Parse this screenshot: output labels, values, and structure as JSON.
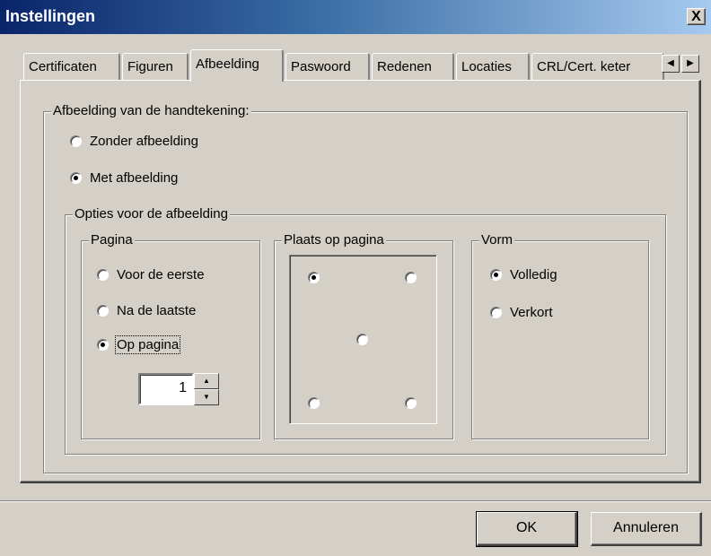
{
  "window": {
    "title": "Instellingen",
    "close_label": "X"
  },
  "tabs": [
    {
      "label": "Certificaten"
    },
    {
      "label": "Figuren"
    },
    {
      "label": "Afbeelding",
      "active": true
    },
    {
      "label": "Paswoord"
    },
    {
      "label": "Redenen"
    },
    {
      "label": "Locaties"
    },
    {
      "label": "CRL/Cert. keter"
    }
  ],
  "tab_scroll": {
    "left": "◀",
    "right": "▶"
  },
  "signature_image": {
    "legend": "Afbeelding van de handtekening:",
    "options": [
      {
        "label": "Zonder afbeelding",
        "selected": false
      },
      {
        "label": "Met afbeelding",
        "selected": true
      }
    ]
  },
  "image_options": {
    "legend": "Opties voor de afbeelding",
    "page": {
      "legend": "Pagina",
      "options": [
        {
          "label": "Voor de eerste",
          "selected": false
        },
        {
          "label": "Na de laatste",
          "selected": false
        },
        {
          "label": "Op pagina",
          "selected": true
        }
      ],
      "page_number": "1",
      "spin_up": "▲",
      "spin_down": "▼"
    },
    "position": {
      "legend": "Plaats op pagina",
      "selected": "top-left"
    },
    "shape": {
      "legend": "Vorm",
      "options": [
        {
          "label": "Volledig",
          "selected": true
        },
        {
          "label": "Verkort",
          "selected": false
        }
      ]
    }
  },
  "buttons": {
    "ok": "OK",
    "cancel": "Annuleren"
  },
  "colors": {
    "face": "#d4d0c8",
    "title_start": "#0a246a",
    "title_end": "#a6caf0"
  }
}
